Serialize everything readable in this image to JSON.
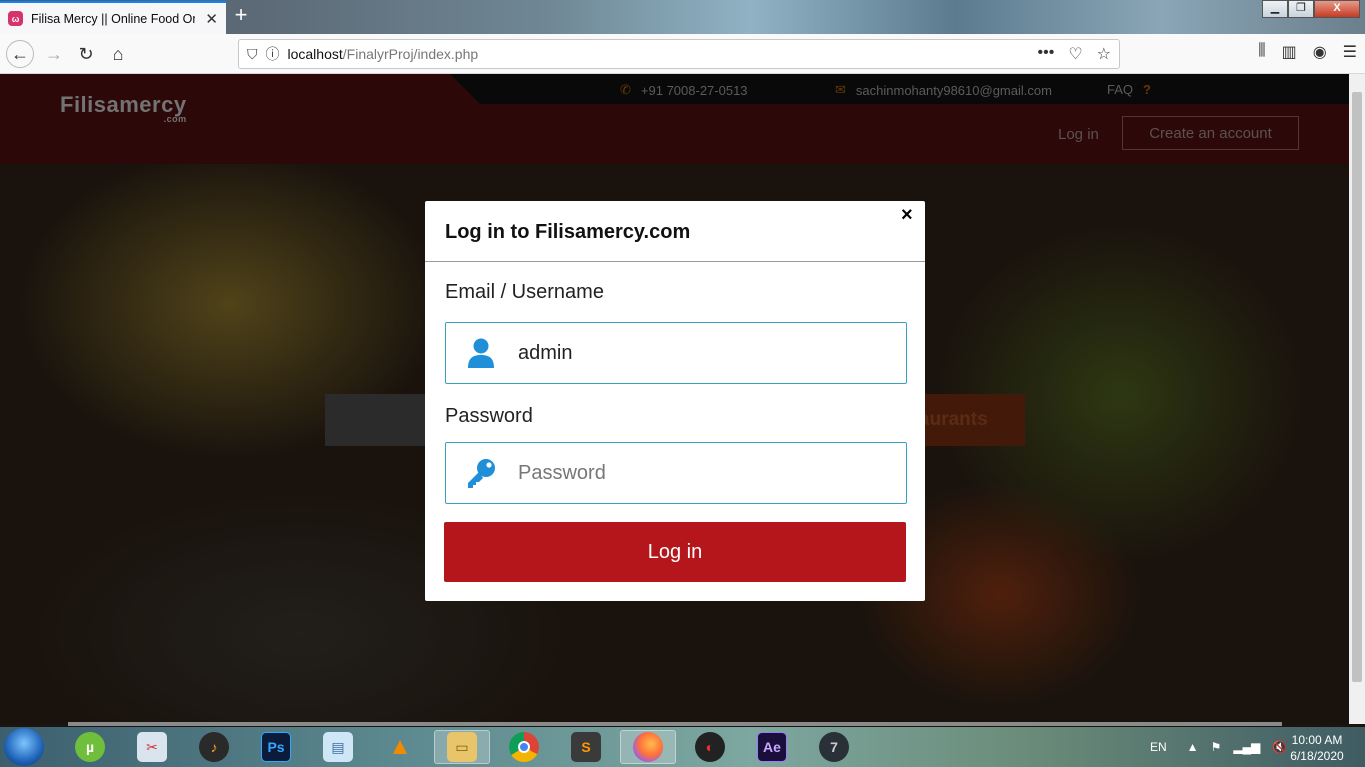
{
  "browser": {
    "tab_title": "Filisa Mercy || Online Food Ord",
    "tab_favicon_letter": "ω",
    "url_host": "localhost",
    "url_path": "/FinalyrProj/index.php",
    "window_min": "▁",
    "window_max": "❐",
    "window_close": "X"
  },
  "site": {
    "phone": "+91 7008-27-0513",
    "email": "sachinmohanty98610@gmail.com",
    "faq": "FAQ",
    "faq_mark": "?",
    "logo_main": "Filisamercy",
    "logo_sub": ".com",
    "header_login": "Log in",
    "header_create": "Create an account",
    "search_button_partial": "aurants"
  },
  "modal": {
    "title": "Log in to Filisamercy.com",
    "close": "×",
    "email_label": "Email / Username",
    "email_value": "admin",
    "password_label": "Password",
    "password_placeholder": "Password",
    "login_button": "Log in"
  },
  "taskbar": {
    "apps": [
      "utorrent",
      "snipping-tool",
      "fl-studio",
      "photoshop",
      "notepad",
      "vlc",
      "file-explorer",
      "chrome",
      "sublime-text",
      "firefox",
      "davinci",
      "after-effects",
      "windows-7-badge"
    ],
    "ps_label": "Ps",
    "ae_label": "Ae",
    "lang": "EN",
    "time": "10:00 AM",
    "date": "6/18/2020"
  },
  "colors": {
    "accent_red": "#b5161b",
    "header_dark_red": "#3c0b0b",
    "input_border": "#3aa0c0",
    "icon_blue": "#1e8fd8"
  }
}
